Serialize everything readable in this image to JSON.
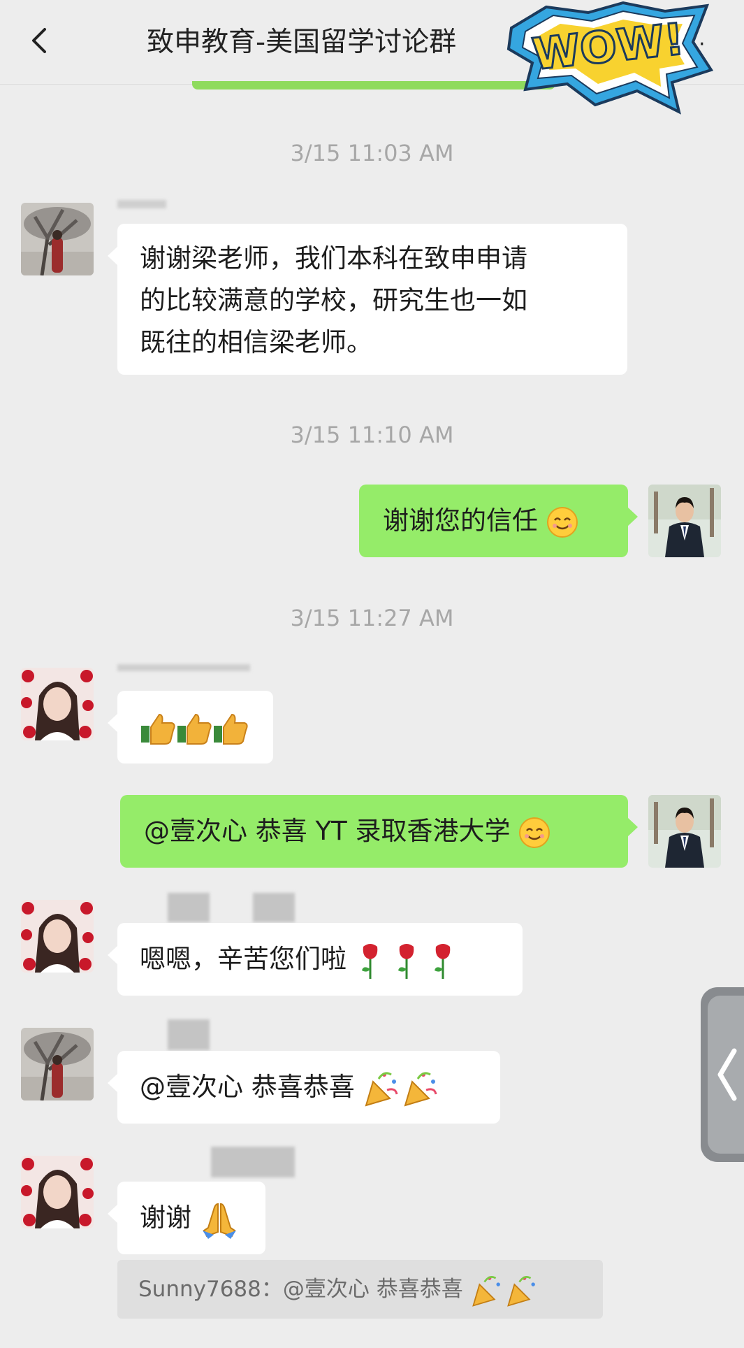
{
  "header": {
    "title": "致申教育-美国留学讨论群",
    "more_label": "·"
  },
  "sticker": "WOW!",
  "timestamps": [
    "3/15 11:03 AM",
    "3/15 11:10 AM",
    "3/15 11:27 AM"
  ],
  "messages": [
    {
      "side": "in",
      "lines": [
        "谢谢梁老师，我们本科在致申申请",
        "的比较满意的学校，研究生也一如",
        "既往的相信梁老师。"
      ]
    },
    {
      "side": "out",
      "text": "谢谢您的信任",
      "emoji": "smile-emoji"
    },
    {
      "side": "in",
      "emoji": "thumbs-up-emoji x3"
    },
    {
      "side": "out",
      "text": "@壹次心 恭喜 YT 录取香港大学",
      "emoji": "smile-emoji"
    },
    {
      "side": "in",
      "text": "嗯嗯，辛苦您们啦",
      "emoji": "rose-emoji x3"
    },
    {
      "side": "in",
      "text": "@壹次心 恭喜恭喜",
      "emoji": "party-popper-emoji x2"
    },
    {
      "side": "in",
      "text": "谢谢",
      "emoji": "pray-emoji"
    }
  ],
  "quote": "Sunny7688：@壹次心 恭喜恭喜"
}
